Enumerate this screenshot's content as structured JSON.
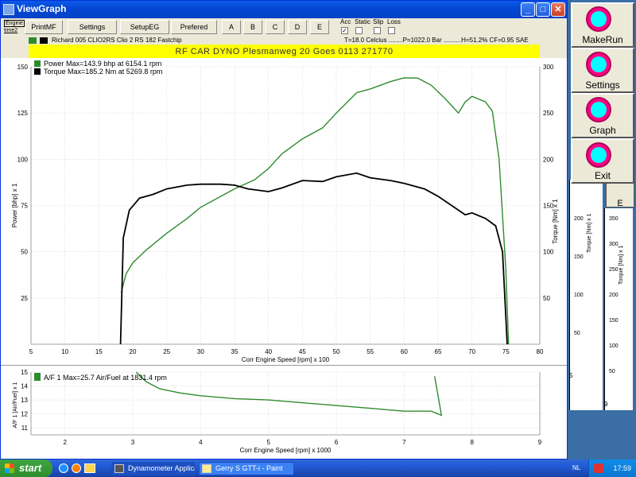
{
  "window": {
    "title": "ViewGraph",
    "controls": {
      "minimize": "_",
      "maximize": "□",
      "close": "✕"
    }
  },
  "toolbar": {
    "side_labels": [
      "Engine",
      "time2"
    ],
    "buttons": [
      "PrintMF",
      "Settings",
      "SetupEG",
      "Prefered",
      "A",
      "B",
      "C",
      "D",
      "E"
    ],
    "options": {
      "labels": [
        "Acc",
        "Static",
        "Slip",
        "Loss"
      ],
      "checked": [
        true,
        false,
        false,
        false
      ]
    }
  },
  "info": {
    "vehicle": "Richard 005 CLIO2RS    Clio 2 RS 182 Fastchip",
    "conditions": "T=18.0 Celcius ........P=1022.0 Bar ..........H=51.2% CF=0.95 SAE"
  },
  "banner": "RF CAR DYNO  Plesmanweg 20 Goes   0113 271770",
  "colors": {
    "power": "#2e8b2e",
    "torque": "#000000",
    "af": "#2e8b2e",
    "banner": "#ffff00"
  },
  "main_chart": {
    "legend": [
      "Power  Max=143.9 bhp at 6154.1 rpm",
      "Torque  Max=185.2 Nm at 5269.8 rpm"
    ],
    "ylabel_left": "Power [bhp] x 1",
    "ylabel_right": "Torque [Nm] x 1",
    "xlabel": "Corr Engine Speed [rpm] x 100",
    "x_ticks": [
      "5",
      "10",
      "15",
      "20",
      "25",
      "30",
      "35",
      "40",
      "45",
      "50",
      "55",
      "60",
      "65",
      "70",
      "75",
      "80"
    ],
    "y_left_ticks": [
      "25",
      "50",
      "75",
      "100",
      "125",
      "150"
    ],
    "y_right_ticks": [
      "50",
      "100",
      "150",
      "200",
      "250",
      "300"
    ]
  },
  "af_chart": {
    "legend": "A/F 1  Max=25.7 Air/Fuel at 1831.4 rpm",
    "ylabel": "A/F 1 [Air/Fuel] x 1",
    "xlabel": "Corr Engine Speed [rpm] x 1000",
    "x_ticks": [
      "2",
      "3",
      "4",
      "5",
      "6",
      "7",
      "8",
      "9"
    ],
    "y_ticks": [
      "11",
      "12",
      "13",
      "14",
      "15"
    ]
  },
  "chart_data": [
    {
      "type": "line",
      "title": "RF CAR DYNO  Plesmanweg 20 Goes   0113 271770",
      "xlabel": "Corr Engine Speed [rpm] x 100",
      "ylabel": "Power [bhp] x 1",
      "ylabel_right": "Torque [Nm] x 1",
      "xlim": [
        5,
        80
      ],
      "ylim": [
        0,
        150
      ],
      "ylim_right": [
        0,
        300
      ],
      "grid": true,
      "series": [
        {
          "name": "Power",
          "axis": "left",
          "x": [
            18.3,
            19,
            20,
            22,
            25,
            28,
            30,
            33,
            35,
            38,
            40,
            42,
            45,
            48,
            50,
            53,
            55,
            58,
            60,
            62,
            64,
            66,
            68,
            69,
            70,
            72,
            73,
            74,
            75,
            75.4
          ],
          "y": [
            28,
            38,
            44,
            51,
            60,
            68,
            74,
            80,
            84,
            89,
            95,
            103,
            111,
            117,
            125,
            136,
            138,
            142,
            144,
            143.9,
            140,
            133,
            125,
            131,
            134,
            131,
            126,
            100,
            40,
            0
          ]
        },
        {
          "name": "Torque",
          "axis": "right",
          "x": [
            18.2,
            18.6,
            19.5,
            21,
            23,
            25,
            28,
            30,
            33,
            35,
            37,
            40,
            42,
            45,
            48,
            50,
            53,
            55,
            58,
            60,
            63,
            65,
            67,
            69,
            70,
            72,
            73.5,
            74.5,
            75.2
          ],
          "y": [
            0,
            115,
            145,
            158,
            162,
            168,
            172,
            173,
            173,
            172,
            168,
            165,
            169,
            177,
            176,
            181,
            185,
            180,
            177,
            174,
            168,
            160,
            150,
            140,
            142,
            136,
            128,
            100,
            0
          ]
        }
      ]
    },
    {
      "type": "line",
      "xlabel": "Corr Engine Speed [rpm] x 1000",
      "ylabel": "A/F 1 [Air/Fuel] x 1",
      "xlim": [
        1.5,
        9
      ],
      "ylim": [
        10.5,
        15
      ],
      "grid": true,
      "series": [
        {
          "name": "A/F 1",
          "x": [
            3.05,
            3.2,
            3.4,
            3.7,
            4.0,
            4.5,
            5.0,
            5.5,
            6.0,
            6.5,
            7.0,
            7.2,
            7.4,
            7.55,
            7.45
          ],
          "y": [
            15,
            14.3,
            13.8,
            13.5,
            13.3,
            13.1,
            13.0,
            12.8,
            12.6,
            12.4,
            12.2,
            12.2,
            12.2,
            11.9,
            14.7
          ]
        }
      ]
    }
  ],
  "side_panel": {
    "buttons": [
      "MakeRun",
      "Settings",
      "Graph",
      "Exit"
    ],
    "peek_labels": [
      "Torque [Nm] x 1",
      "Torque [Nm] x 1"
    ],
    "peek_ticks": [
      "200",
      "150",
      "100",
      "50"
    ],
    "peek_ticks_right": [
      "350",
      "300",
      "250",
      "200",
      "150",
      "100",
      "50"
    ],
    "peek_fragment": "E",
    "peek_small": [
      "5",
      "9"
    ]
  },
  "taskbar": {
    "start": "start",
    "tasks": [
      "Dynamometer Applica...",
      "Gerry S GTT-i - Paint"
    ],
    "lang": "NL",
    "clock": "17:59"
  }
}
